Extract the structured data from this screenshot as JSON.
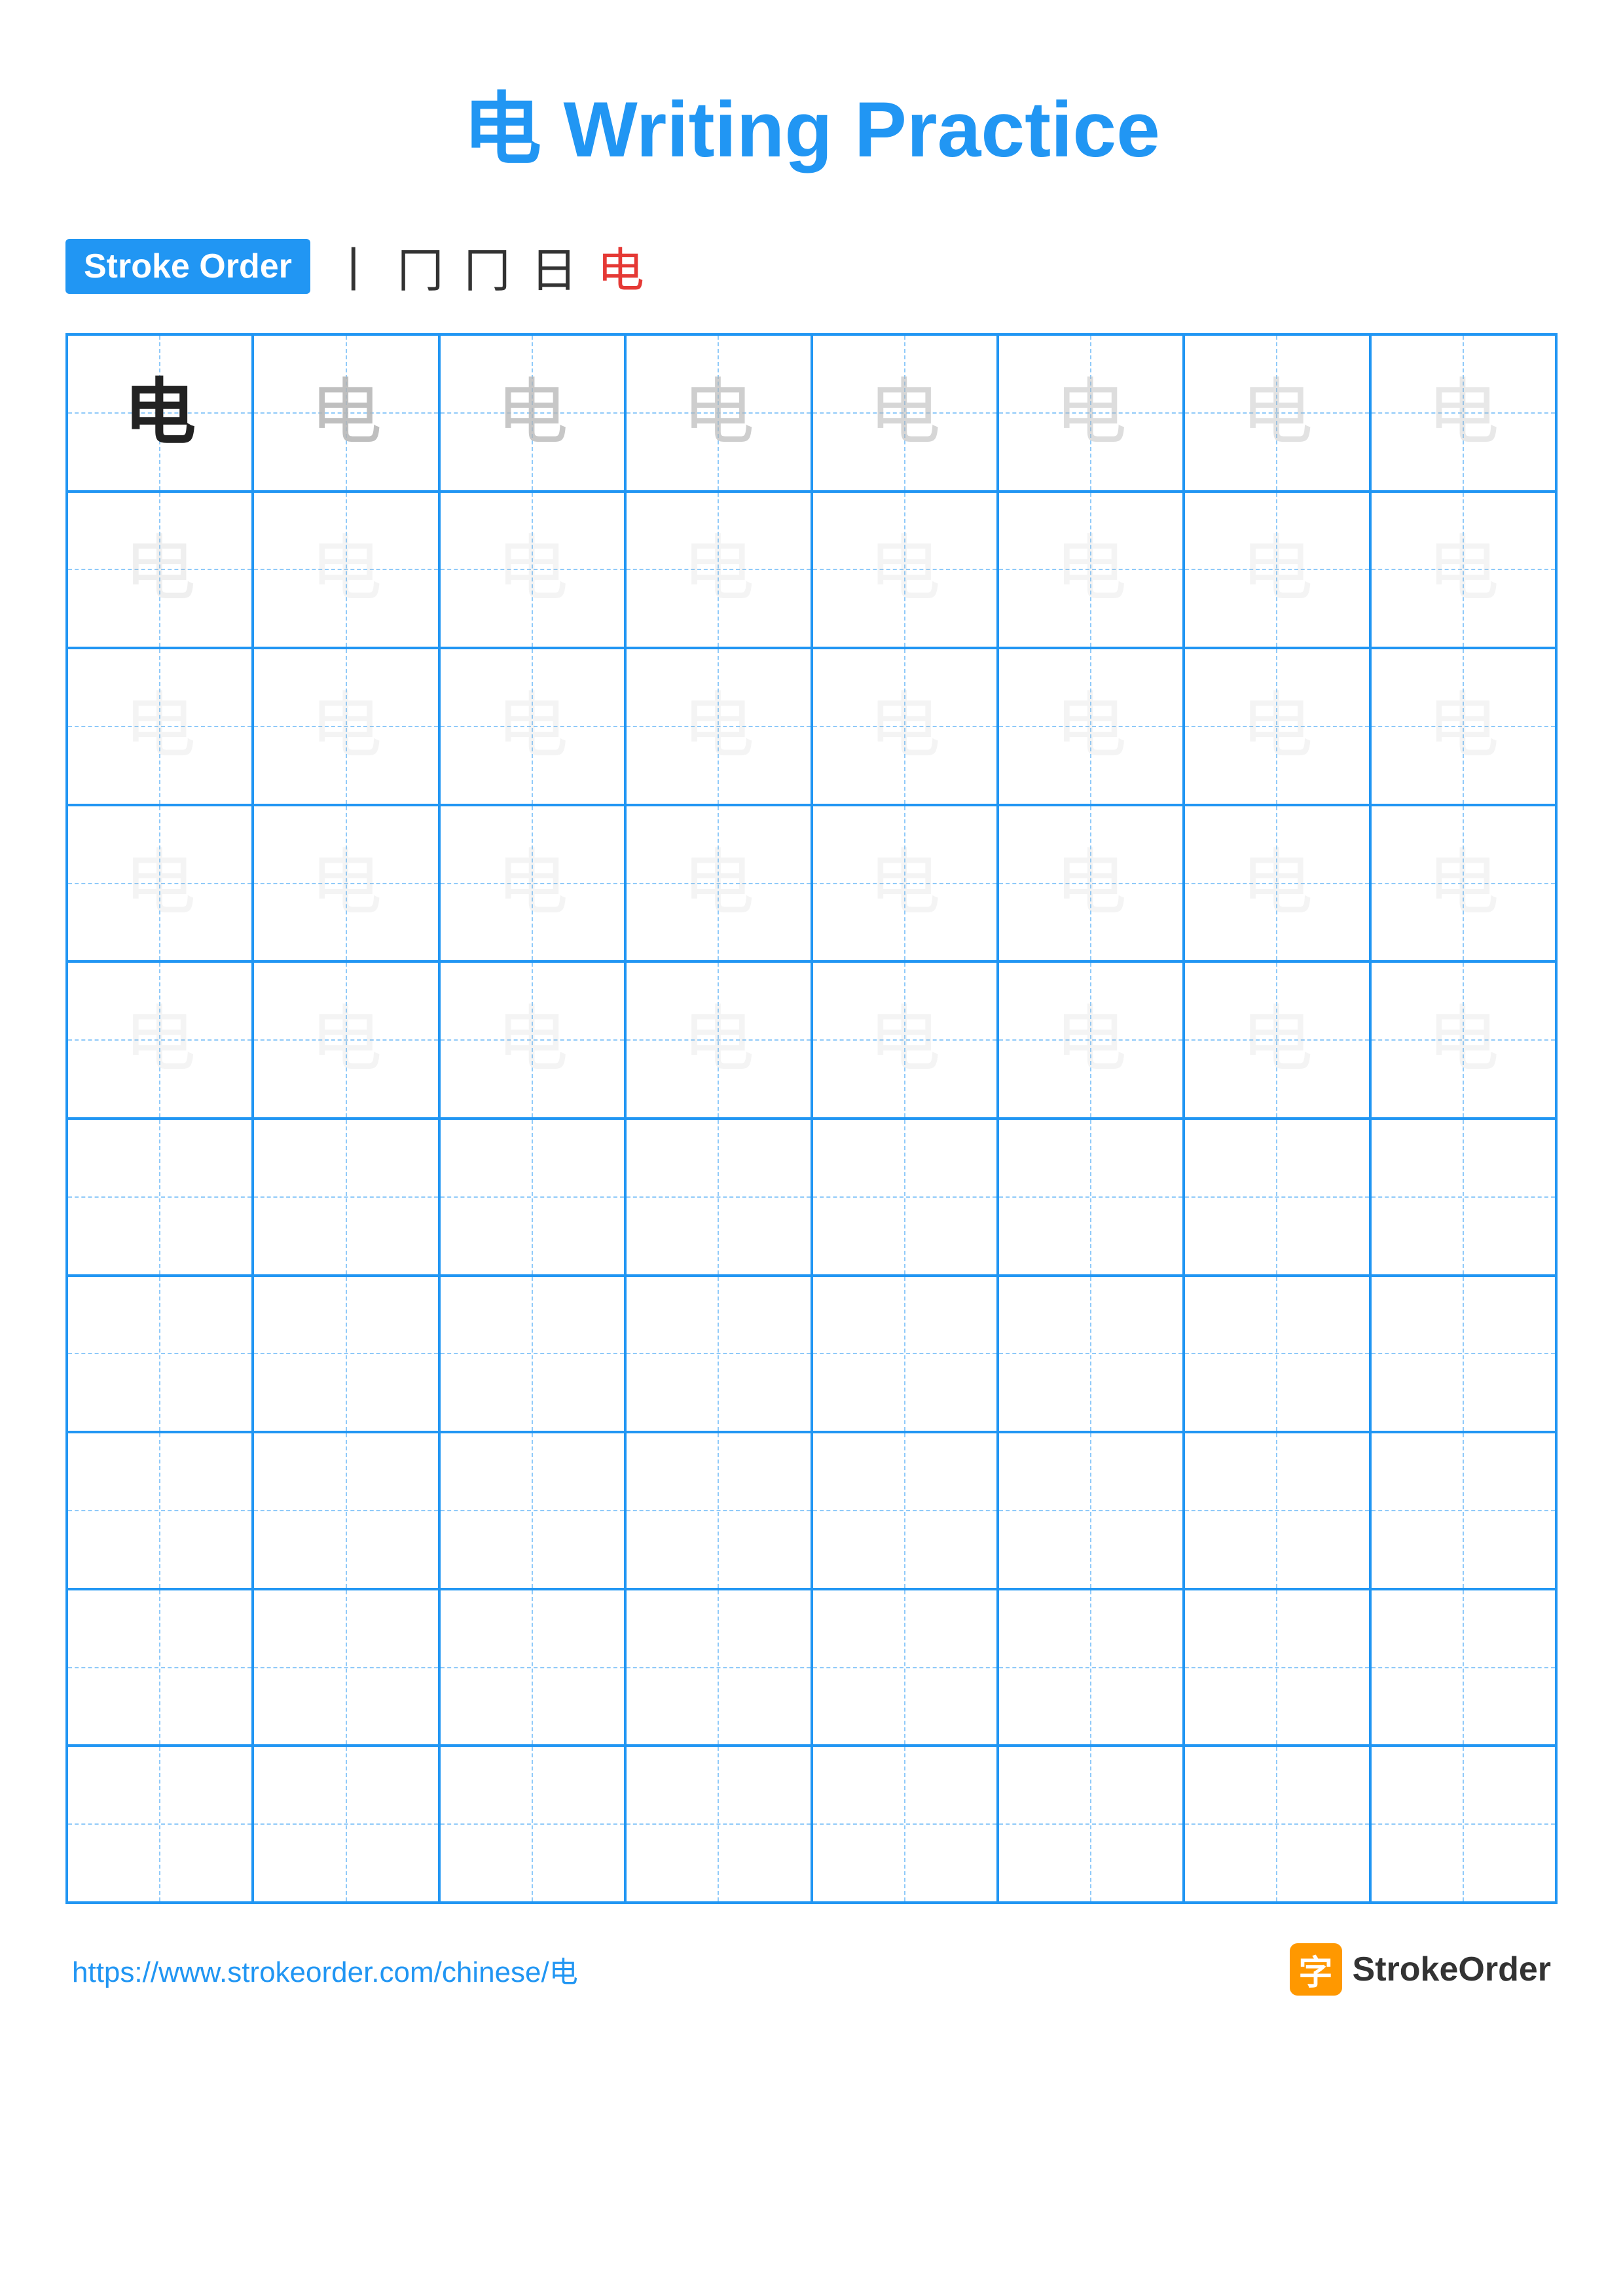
{
  "page": {
    "title": "电 Writing Practice",
    "character": "电",
    "stroke_order_label": "Stroke Order",
    "stroke_sequence": [
      "丨",
      "冂",
      "冂",
      "日",
      "电"
    ],
    "stroke_sequence_last_red": true,
    "footer_url": "https://www.strokeorder.com/chinese/电",
    "footer_brand": "StrokeOrder",
    "footer_icon_char": "字"
  },
  "grid": {
    "rows": 10,
    "cols": 8,
    "character": "电",
    "fade_rows": 5,
    "empty_rows": 5
  }
}
